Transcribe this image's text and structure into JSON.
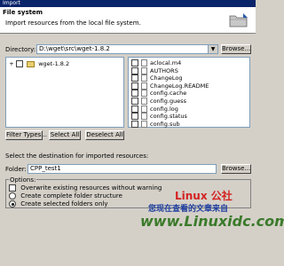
{
  "window": {
    "title": "Import"
  },
  "banner": {
    "title": "File system",
    "subtitle": "Import resources from the local file system."
  },
  "directory": {
    "label": "Directory:",
    "value": "D:\\wget\\src\\wget-1.8.2",
    "browse_label": "Browse..."
  },
  "tree": {
    "root_label": "wget-1.8.2",
    "expand_glyph": "+"
  },
  "files": [
    {
      "name": "aclocal.m4",
      "checked": false
    },
    {
      "name": "AUTHORS",
      "checked": false
    },
    {
      "name": "ChangeLog",
      "checked": false
    },
    {
      "name": "ChangeLog.README",
      "checked": false
    },
    {
      "name": "config.cache",
      "checked": false
    },
    {
      "name": "config.guess",
      "checked": false
    },
    {
      "name": "config.log",
      "checked": false
    },
    {
      "name": "config.status",
      "checked": false
    },
    {
      "name": "config.sub",
      "checked": false
    }
  ],
  "buttons": {
    "filter_types": "Filter Types...",
    "select_all": "Select All",
    "deselect_all": "Deselect All"
  },
  "destination": {
    "heading": "Select the destination for imported resources:",
    "folder_label": "Folder:",
    "folder_value": "CPP_test1",
    "browse_label": "Browse..."
  },
  "options": {
    "heading": "Options:",
    "overwrite": {
      "label": "Overwrite existing resources without warning",
      "checked": false
    },
    "create_complete": {
      "label": "Create complete folder structure",
      "selected": false
    },
    "create_selected": {
      "label": "Create selected folders only",
      "selected": true
    }
  },
  "watermark": {
    "line1": "Linux 公社",
    "line2": "您现在查看的文章来自",
    "line3": "www.Linuxidc.com"
  },
  "colors": {
    "titlebar": "#0a246a",
    "dialog_bg": "#d4d0c8",
    "panel_border": "#7f9db9"
  }
}
